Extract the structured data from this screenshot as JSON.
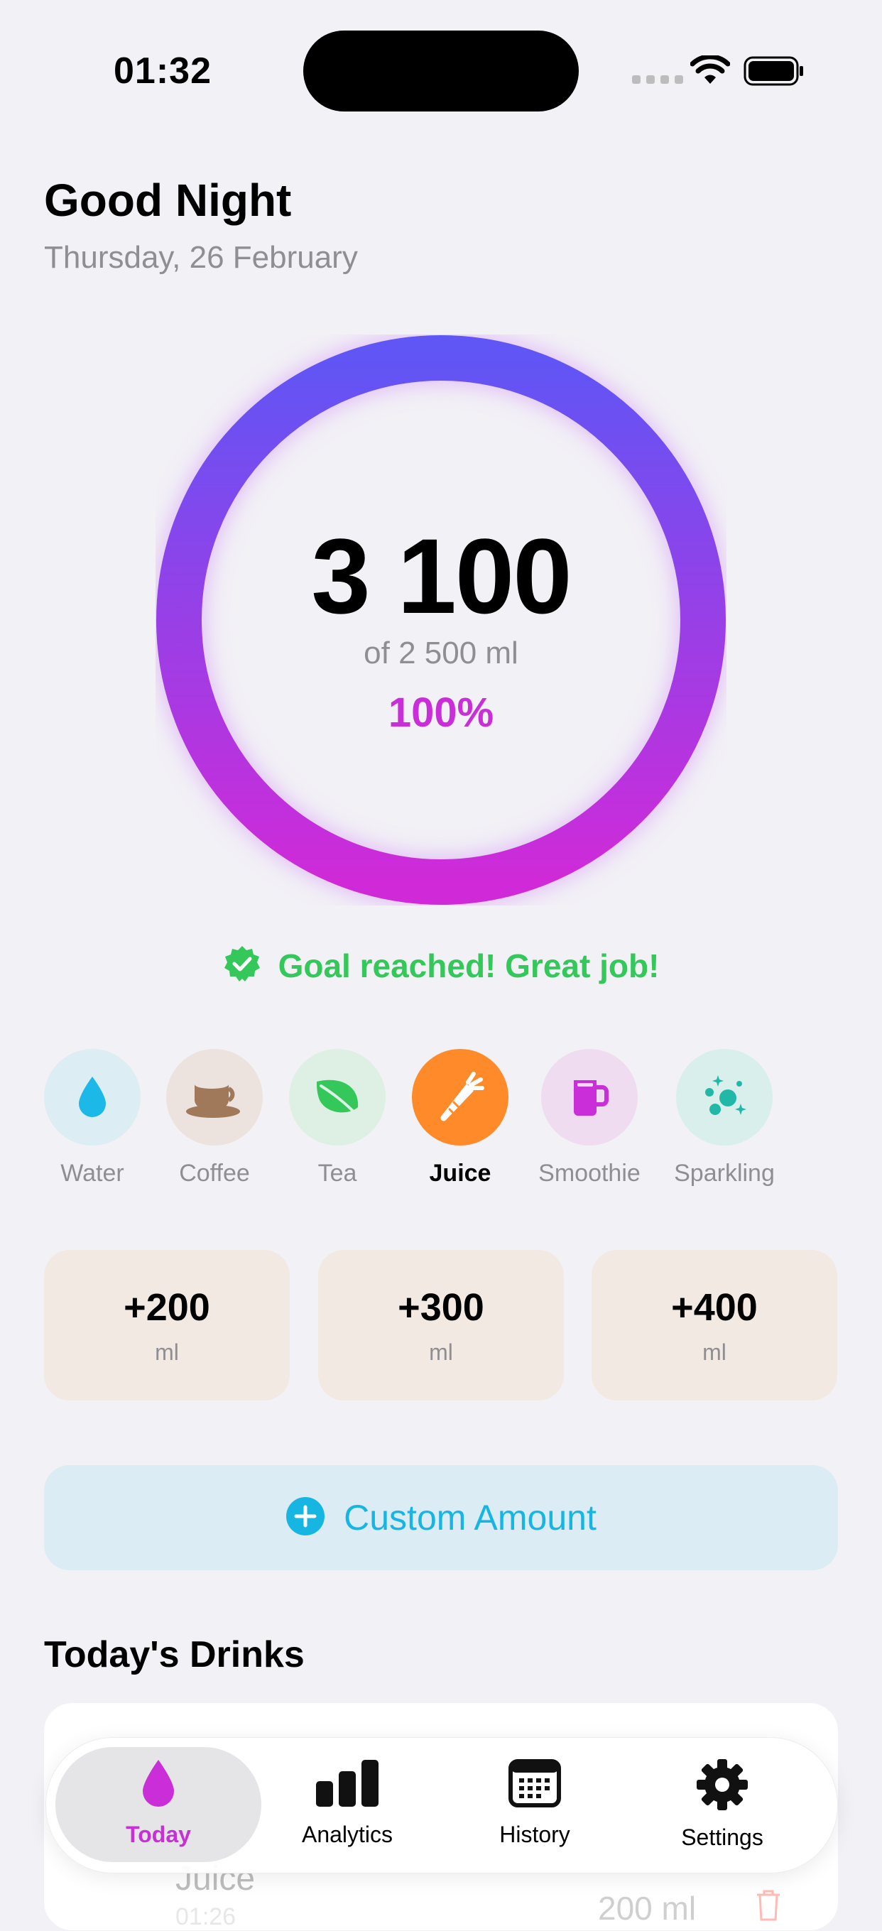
{
  "status_bar": {
    "time": "01:32"
  },
  "header": {
    "greeting": "Good Night",
    "date": "Thursday, 26 February"
  },
  "progress": {
    "total_display": "3 100",
    "goal_display": "of 2 500 ml",
    "percent_display": "100%",
    "fraction": 1.0
  },
  "goal_message": "Goal reached! Great job!",
  "drink_types": [
    {
      "label": "Water",
      "icon": "water-drop-icon",
      "color": "#1cb8e8",
      "bg": "#dceef4",
      "selected": false
    },
    {
      "label": "Coffee",
      "icon": "coffee-cup-icon",
      "color": "#a0785a",
      "bg": "#ede3de",
      "selected": false
    },
    {
      "label": "Tea",
      "icon": "leaf-icon",
      "color": "#34c759",
      "bg": "#def0e4",
      "selected": false
    },
    {
      "label": "Juice",
      "icon": "carrot-icon",
      "color": "#ffffff",
      "bg": "#ff8a2a",
      "selected": true
    },
    {
      "label": "Smoothie",
      "icon": "mug-icon",
      "color": "#c92ed8",
      "bg": "#efdcf0",
      "selected": false
    },
    {
      "label": "Sparkling",
      "icon": "bubbles-icon",
      "color": "#22b8a8",
      "bg": "#d9efec",
      "selected": false
    }
  ],
  "quick_amounts": [
    {
      "value": "+200",
      "unit": "ml"
    },
    {
      "value": "+300",
      "unit": "ml"
    },
    {
      "value": "+400",
      "unit": "ml"
    }
  ],
  "custom_amount_label": "Custom Amount",
  "todays_drinks": {
    "title": "Today's Drinks",
    "entries": [
      {
        "name": "Juice",
        "time": "01:26",
        "amount": "200 ml"
      }
    ]
  },
  "tabs": [
    {
      "label": "Today",
      "icon": "drop-icon",
      "selected": true
    },
    {
      "label": "Analytics",
      "icon": "bar-chart-icon",
      "selected": false
    },
    {
      "label": "History",
      "icon": "calendar-icon",
      "selected": false
    },
    {
      "label": "Settings",
      "icon": "gear-icon",
      "selected": false
    }
  ],
  "colors": {
    "accent": "#c92ed8",
    "ring_start": "#d02ad8",
    "ring_end": "#6055f5",
    "success": "#34c759",
    "custom_accent": "#17b5e2"
  }
}
